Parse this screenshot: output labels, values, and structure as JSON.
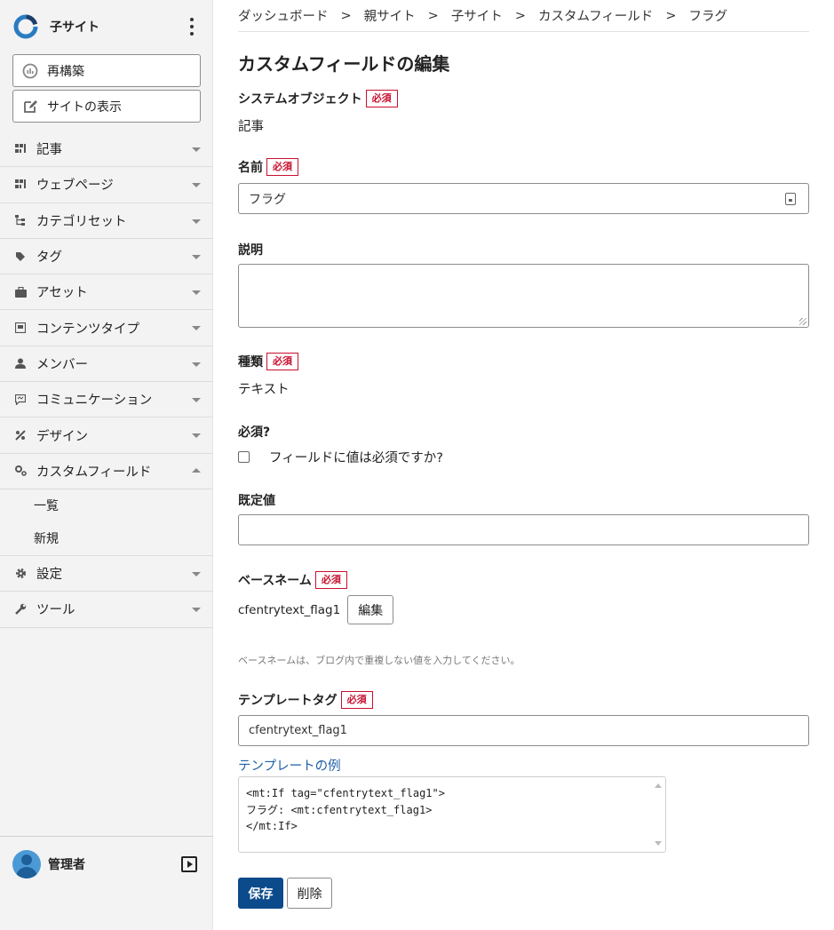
{
  "sidebar": {
    "site_name": "子サイト",
    "rebuild_label": "再構築",
    "view_site_label": "サイトの表示",
    "menu": [
      {
        "label": "記事",
        "icon": "entries-icon"
      },
      {
        "label": "ウェブページ",
        "icon": "pages-icon"
      },
      {
        "label": "カテゴリセット",
        "icon": "category-icon"
      },
      {
        "label": "タグ",
        "icon": "tag-icon"
      },
      {
        "label": "アセット",
        "icon": "asset-icon"
      },
      {
        "label": "コンテンツタイプ",
        "icon": "content-type-icon"
      },
      {
        "label": "メンバー",
        "icon": "member-icon"
      },
      {
        "label": "コミュニケーション",
        "icon": "comment-icon"
      },
      {
        "label": "デザイン",
        "icon": "design-icon"
      },
      {
        "label": "カスタムフィールド",
        "icon": "custom-field-icon"
      },
      {
        "label": "設定",
        "icon": "gear-icon"
      },
      {
        "label": "ツール",
        "icon": "wrench-icon"
      }
    ],
    "submenu": [
      {
        "label": "一覧"
      },
      {
        "label": "新規"
      }
    ],
    "user_name": "管理者"
  },
  "breadcrumb": [
    "ダッシュボード",
    "親サイト",
    "子サイト",
    "カスタムフィールド",
    "フラグ"
  ],
  "page_title": "カスタムフィールドの編集",
  "required_badge": "必須",
  "fields": {
    "system_object": {
      "label": "システムオブジェクト",
      "value": "記事"
    },
    "name": {
      "label": "名前",
      "value": "フラグ"
    },
    "description": {
      "label": "説明",
      "value": ""
    },
    "type": {
      "label": "種類",
      "value": "テキスト"
    },
    "required": {
      "label": "必須?",
      "checkbox_label": "フィールドに値は必須ですか?"
    },
    "default": {
      "label": "既定値",
      "value": ""
    },
    "basename": {
      "label": "ベースネーム",
      "value": "cfentrytext_flag1",
      "edit_label": "編集",
      "hint": "ベースネームは、ブログ内で重複しない値を入力してください。"
    },
    "template_tag": {
      "label": "テンプレートタグ",
      "value": "cfentrytext_flag1"
    }
  },
  "template_example": {
    "link_label": "テンプレートの例",
    "lines": [
      "<mt:If tag=\"cfentrytext_flag1\">",
      "フラグ: <mt:cfentrytext_flag1>",
      "</mt:If>"
    ]
  },
  "actions": {
    "save_label": "保存",
    "delete_label": "削除"
  },
  "colors": {
    "primary": "#0b4a8b",
    "required": "#c8102e",
    "link": "#1f5fa6"
  }
}
